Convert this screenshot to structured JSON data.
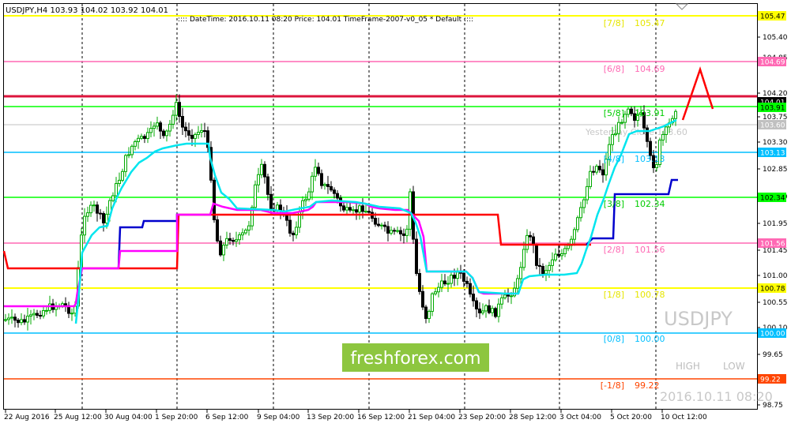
{
  "header": {
    "symbol_line": "USDJPY,H4  103.93 104.02 103.92 104.01",
    "info_line": ":::: DateTime: 2016.10.11 08:20    Price: 104.01    TimeFrame-2007-v0_05     *    Default    ::::"
  },
  "watermark": {
    "symbol": "USDJPY",
    "brand": "freshforex.com",
    "timestamp": "2016.10.11 08:20",
    "high_label": "HIGH",
    "low_label": "LOW"
  },
  "yesterday_label": "Yesterday Close 103.60",
  "price_axis": {
    "ticks": [
      "105.40",
      "104.85",
      "104.20",
      "103.75",
      "103.30",
      "102.85",
      "102.40",
      "101.95",
      "101.45",
      "101.00",
      "100.55",
      "100.10",
      "99.65",
      "99.20",
      "98.75"
    ],
    "markers": [
      {
        "label": "105.47",
        "color": "#ffff00",
        "text_color": "#000000"
      },
      {
        "label": "104.69",
        "color": "#ff69b4",
        "text_color": "#ffffff"
      },
      {
        "label": "104.01",
        "color": "#000000",
        "text_color": "#ffffff"
      },
      {
        "label": "103.91",
        "color": "#00ff00",
        "text_color": "#000000"
      },
      {
        "label": "103.60",
        "color": "#c0c0c0",
        "text_color": "#ffffff"
      },
      {
        "label": "103.13",
        "color": "#00bfff",
        "text_color": "#ffffff"
      },
      {
        "label": "102.34",
        "color": "#00ff00",
        "text_color": "#000000"
      },
      {
        "label": "101.56",
        "color": "#ff69b4",
        "text_color": "#ffffff"
      },
      {
        "label": "100.78",
        "color": "#ffff00",
        "text_color": "#000000"
      },
      {
        "label": "100.00",
        "color": "#00bfff",
        "text_color": "#ffffff"
      },
      {
        "label": "99.22",
        "color": "#ff4500",
        "text_color": "#ffffff"
      }
    ]
  },
  "time_axis": [
    "22 Aug 2016",
    "25 Aug 12:00",
    "30 Aug 04:00",
    "1 Sep 20:00",
    "6 Sep 12:00",
    "9 Sep 04:00",
    "13 Sep 20:00",
    "16 Sep 12:00",
    "21 Sep 04:00",
    "23 Sep 20:00",
    "28 Sep 12:00",
    "3 Oct 04:00",
    "5 Oct 20:00",
    "10 Oct 12:00"
  ],
  "murrey_levels": [
    {
      "tag": "[7/8]",
      "value": "105.47",
      "color": "#e6e600"
    },
    {
      "tag": "[6/8]",
      "value": "104.69",
      "color": "#ff69b4"
    },
    {
      "tag": "[5/8]",
      "value": "103.91",
      "color": "#00cc00"
    },
    {
      "tag": "[4/8]",
      "value": "103.13",
      "color": "#00bfff"
    },
    {
      "tag": "[3/8]",
      "value": "102.34",
      "color": "#00cc00"
    },
    {
      "tag": "[2/8]",
      "value": "101.56",
      "color": "#ff69b4"
    },
    {
      "tag": "[1/8]",
      "value": "100.78",
      "color": "#e6e600"
    },
    {
      "tag": "[0/8]",
      "value": "100.00",
      "color": "#00bfff"
    },
    {
      "tag": "[-1/8]",
      "value": "99.22",
      "color": "#ff4500"
    }
  ]
}
